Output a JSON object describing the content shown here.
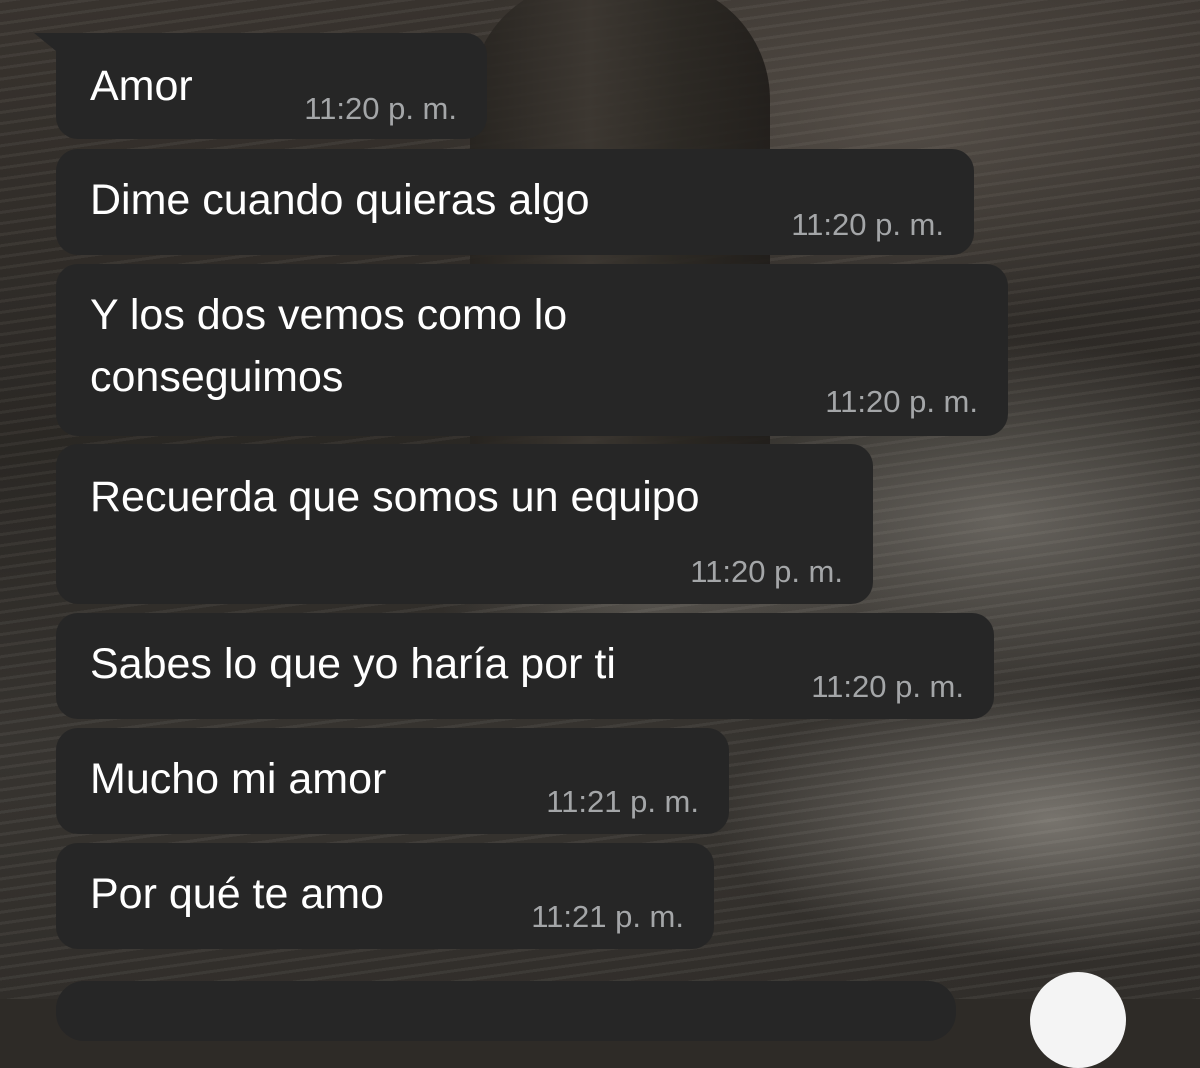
{
  "messages": [
    {
      "text": "Amor",
      "time": "11:20 p. m."
    },
    {
      "text": "Dime cuando quieras algo",
      "time": "11:20 p. m."
    },
    {
      "text": "Y los dos vemos como lo\nconseguimos",
      "time": "11:20 p. m."
    },
    {
      "text": "Recuerda que somos un equipo",
      "time": "11:20 p. m."
    },
    {
      "text": "Sabes lo que yo haría por ti",
      "time": "11:20 p. m."
    },
    {
      "text": "Mucho mi amor",
      "time": "11:21 p. m."
    },
    {
      "text": "Por qué te amo",
      "time": "11:21 p. m."
    }
  ],
  "colors": {
    "bubble": "#262626",
    "text": "#ffffff",
    "timestamp": "#a4a6a8",
    "fab": "#f4f4f4"
  }
}
